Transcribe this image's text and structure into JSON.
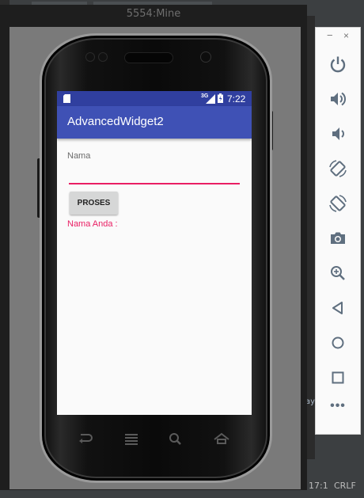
{
  "emulator": {
    "title": "5554:Mine"
  },
  "status_bar": {
    "signal": "3G",
    "time": "7:22"
  },
  "app": {
    "title": "AdvancedWidget2",
    "name_label": "Nama",
    "name_value": "",
    "button_label": "PROSES",
    "result_text": "Nama Anda :"
  },
  "nav_icons": [
    "back-icon",
    "menu-icon",
    "search-icon",
    "home-icon"
  ],
  "tools": [
    "power-icon",
    "volume-up-icon",
    "volume-down-icon",
    "rotate-left-icon",
    "rotate-right-icon",
    "camera-icon",
    "zoom-icon",
    "back-triangle-icon",
    "home-circle-icon",
    "overview-square-icon",
    "more-icon"
  ],
  "tool_panel": {
    "minimize": "−",
    "close": "×",
    "more": "•••"
  },
  "ide": {
    "cursor_position": "17:1",
    "line_separator": "CRLF"
  },
  "colors": {
    "primary": "#3f51b5",
    "primary_dark": "#303f9f",
    "accent": "#e91e63",
    "tool_icon": "#5f6f7f"
  }
}
